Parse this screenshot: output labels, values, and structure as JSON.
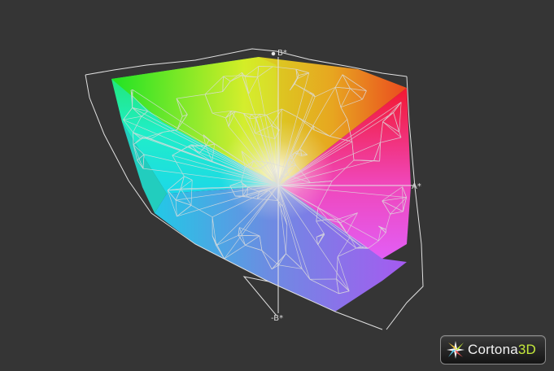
{
  "viewer": {
    "background": "#353535",
    "wire_color": "#dcdcdc"
  },
  "axes": {
    "b_plus": "B*",
    "a_plus": "A*",
    "b_minus": "-B*"
  },
  "logo": {
    "name_main": "Cortona",
    "name_accent": "3D",
    "accent_color": "#c4e93b",
    "icon": "cortona-star-icon"
  },
  "gamut": {
    "corner_colors": {
      "top_left": "#19e219",
      "top": "#f7f01a",
      "top_right": "#ff6a1a",
      "right": "#f0143c",
      "right_low": "#f23cf0",
      "bottom_right": "#8855f0",
      "bottom": "#3a8ae6",
      "left_low": "#1ef0e0",
      "center": "#f7f3dc"
    }
  }
}
